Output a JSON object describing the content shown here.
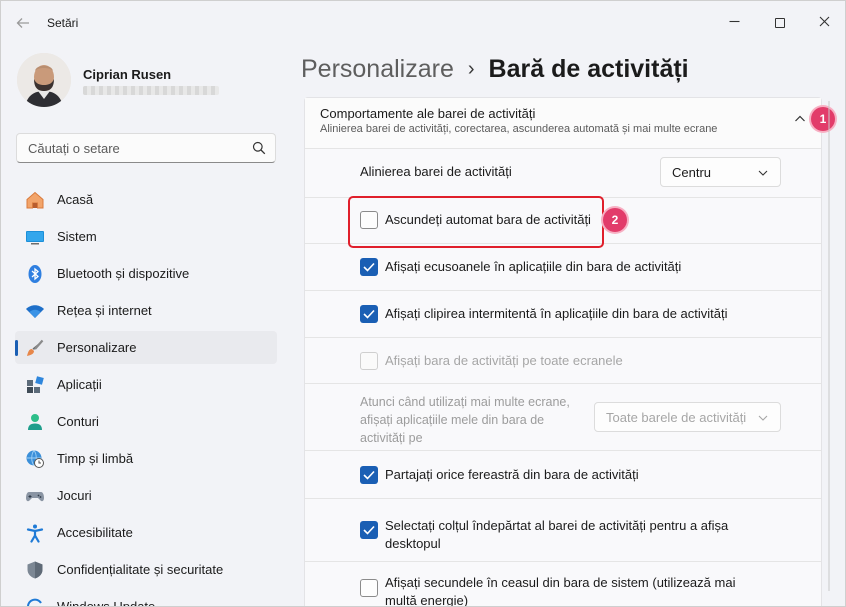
{
  "window": {
    "title": "Setări",
    "back_icon": "arrow-left-icon",
    "controls": [
      "minimize-icon",
      "maximize-icon",
      "close-icon"
    ]
  },
  "profile": {
    "name": "Ciprian Rusen",
    "email_redacted": true
  },
  "search": {
    "placeholder": "Căutați o setare",
    "icon": "search-icon"
  },
  "sidebar": {
    "items": [
      {
        "label": "Acasă",
        "icon": "home-icon",
        "active": false
      },
      {
        "label": "Sistem",
        "icon": "monitor-icon",
        "active": false
      },
      {
        "label": "Bluetooth și dispozitive",
        "icon": "bluetooth-icon",
        "active": false
      },
      {
        "label": "Rețea și internet",
        "icon": "wifi-icon",
        "active": false
      },
      {
        "label": "Personalizare",
        "icon": "brush-icon",
        "active": true
      },
      {
        "label": "Aplicații",
        "icon": "apps-icon",
        "active": false
      },
      {
        "label": "Conturi",
        "icon": "person-icon",
        "active": false
      },
      {
        "label": "Timp și limbă",
        "icon": "globe-clock-icon",
        "active": false
      },
      {
        "label": "Jocuri",
        "icon": "gamepad-icon",
        "active": false
      },
      {
        "label": "Accesibilitate",
        "icon": "accessibility-icon",
        "active": false
      },
      {
        "label": "Confidențialitate și securitate",
        "icon": "shield-icon",
        "active": false
      },
      {
        "label": "Windows Update",
        "icon": "update-icon",
        "active": false
      }
    ]
  },
  "breadcrumb": {
    "parent": "Personalizare",
    "separator": "›",
    "current": "Bară de activități"
  },
  "section": {
    "title": "Comportamente ale barei de activități",
    "description": "Alinierea barei de activități, corectarea, ascunderea automată și mai multe ecrane",
    "expanded": true,
    "alignment": {
      "label": "Alinierea barei de activități",
      "value": "Centru"
    },
    "options": [
      {
        "label": "Ascundeți automat bara de activități",
        "checked": false,
        "disabled": false
      },
      {
        "label": "Afișați ecusoanele în aplicațiile din bara de activități",
        "checked": true,
        "disabled": false
      },
      {
        "label": "Afișați clipirea intermitentă în aplicațiile din bara de activități",
        "checked": true,
        "disabled": false
      },
      {
        "label": "Afișați bara de activități pe toate ecranele",
        "checked": false,
        "disabled": true
      }
    ],
    "multi_display": {
      "label": "Atunci când utilizați mai multe ecrane, afișați aplicațiile mele din bara de activități pe",
      "value": "Toate barele de activități",
      "disabled": true
    },
    "options2": [
      {
        "label": "Partajați orice fereastră din bara de activități",
        "checked": true,
        "disabled": false
      },
      {
        "label": "Selectați colțul îndepărtat al barei de activități pentru a afișa desktopul",
        "checked": true,
        "disabled": false
      },
      {
        "label": "Afișați secundele în ceasul din bara de sistem (utilizează mai multă energie)",
        "checked": false,
        "disabled": false
      }
    ]
  },
  "annotations": {
    "badge1": "1",
    "badge2": "2",
    "highlight_color": "#e01f2b",
    "badge_color": "#e23c6a"
  },
  "colors": {
    "accent": "#1a5fb4",
    "background": "#f2f3f7"
  }
}
